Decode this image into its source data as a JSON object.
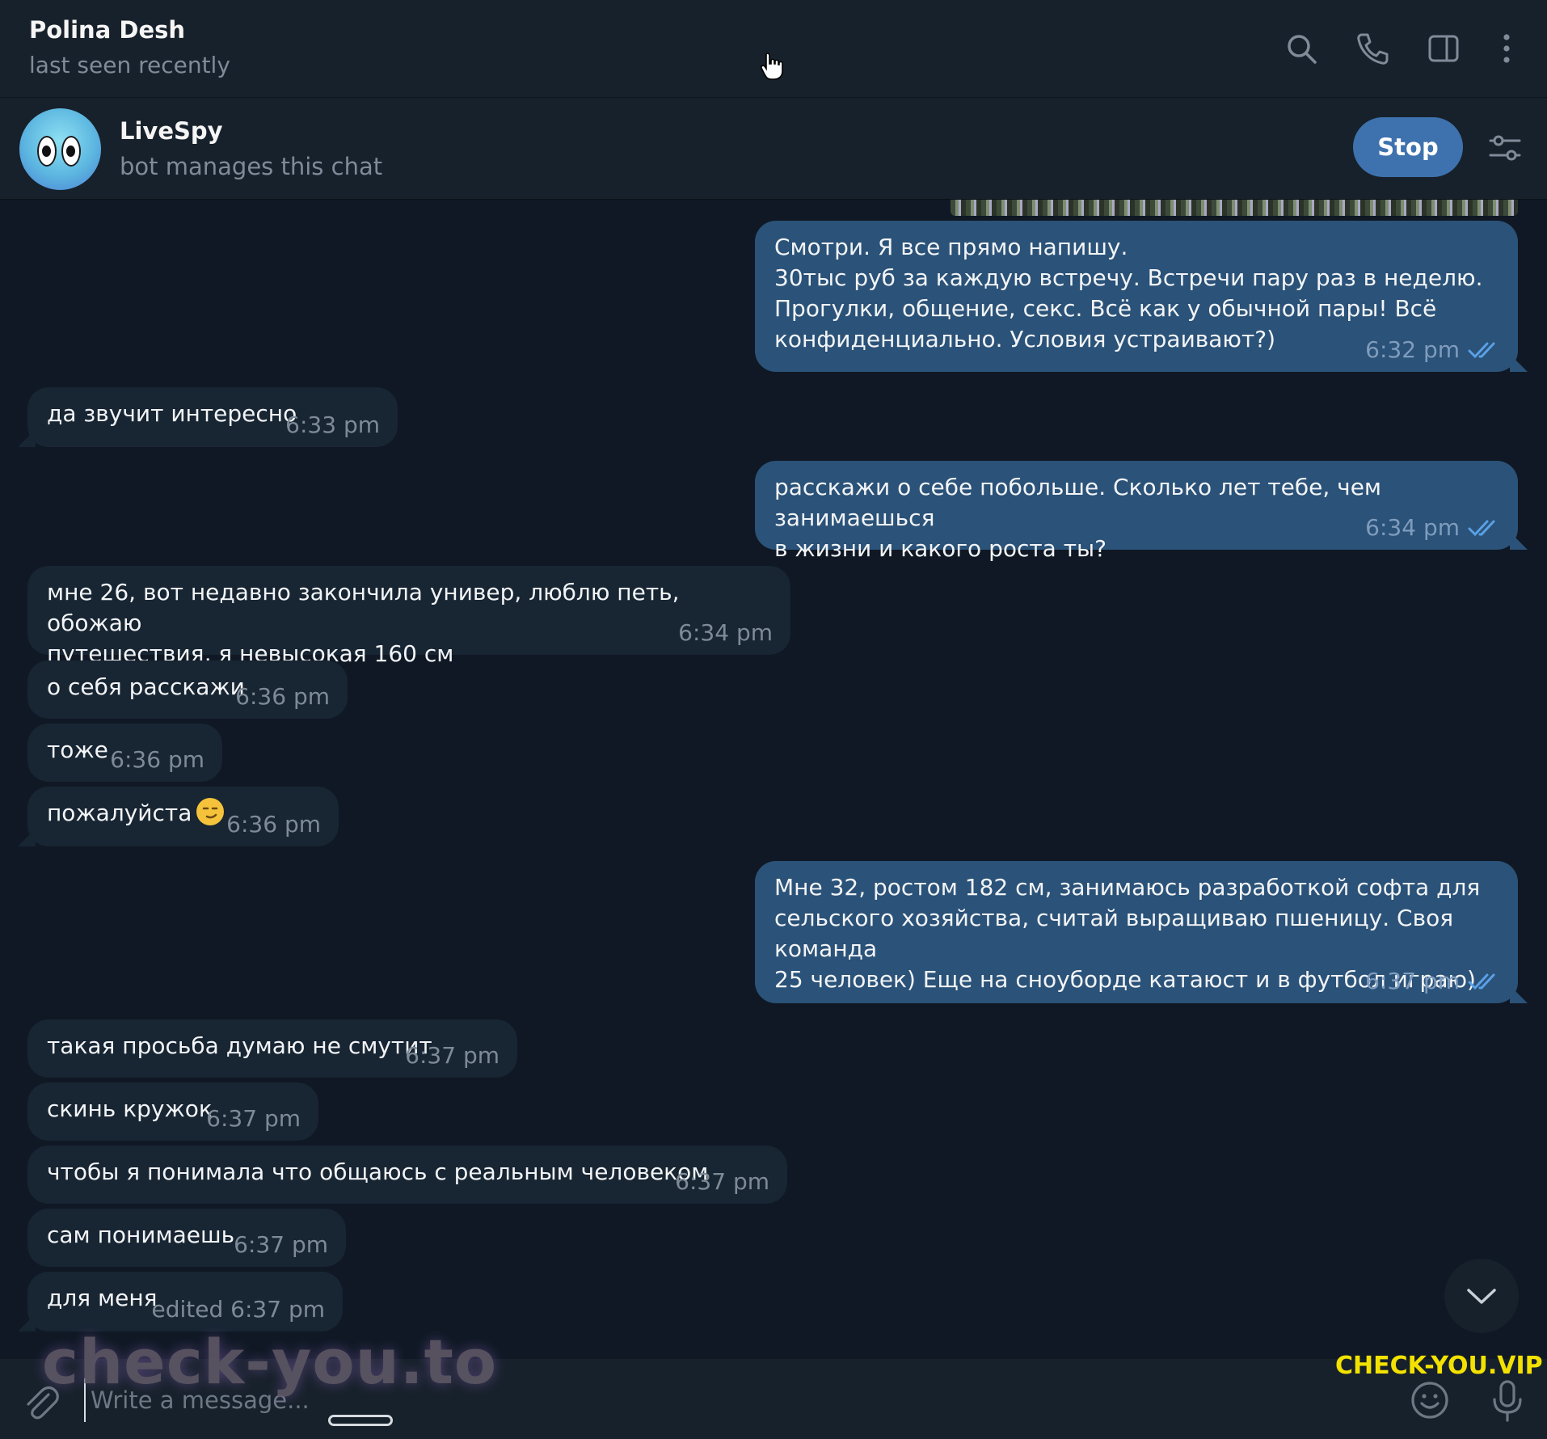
{
  "header": {
    "contact_name": "Polina Desh",
    "status": "last seen recently"
  },
  "bot": {
    "name": "LiveSpy",
    "subtitle": "bot manages this chat",
    "stop_label": "Stop"
  },
  "messages": [
    {
      "dir": "out",
      "text": "Смотри. Я все прямо напишу.\n30тыс руб за каждую встречу. Встречи пару раз в неделю.\nПрогулки, общение, секс. Всё как у обычной пары! Всё\nконфиденциально. Условия устраивают?)",
      "time": "6:32 pm"
    },
    {
      "dir": "in",
      "text": "да звучит интересно",
      "time": "6:33 pm"
    },
    {
      "dir": "out",
      "text": "расскажи о себе побольше. Сколько лет тебе, чем занимаешься\nв жизни и какого роста ты?",
      "time": "6:34 pm"
    },
    {
      "dir": "in",
      "text": "мне 26, вот недавно закончила универ, люблю петь, обожаю\nпутешествия, я невысокая 160 см",
      "time": "6:34 pm"
    },
    {
      "dir": "in",
      "text": "о себя расскажи",
      "time": "6:36 pm"
    },
    {
      "dir": "in",
      "text": "тоже",
      "time": "6:36 pm"
    },
    {
      "dir": "in",
      "text": "пожалуйста",
      "time": "6:36 pm"
    },
    {
      "dir": "out",
      "text": "Мне 32, ростом 182 см, занимаюсь разработкой софта для\nсельского хозяйства, считай выращиваю пшеницу. Своя команда\n25 человек) Еще на сноуборде катаюст и в футбол играю)",
      "time": "6:37 pm"
    },
    {
      "dir": "in",
      "text": "такая просьба думаю не смутит",
      "time": "6:37 pm"
    },
    {
      "dir": "in",
      "text": "скинь кружок",
      "time": "6:37 pm"
    },
    {
      "dir": "in",
      "text": "чтобы я понимала что общаюсь с реальным человеком",
      "time": "6:37 pm"
    },
    {
      "dir": "in",
      "text": "сам понимаешь",
      "time": "6:37 pm"
    },
    {
      "dir": "in",
      "text": "для меня",
      "time": "edited 6:37 pm"
    }
  ],
  "input": {
    "placeholder": "Write a message..."
  },
  "watermarks": {
    "left": "check-you.to",
    "right": "CHECK-YOU.VIP"
  },
  "icons": {
    "search": "search-icon",
    "call": "phone-icon",
    "sidebar": "sidebar-toggle-icon",
    "more": "more-vertical-icon",
    "bot_settings": "sliders-icon",
    "attach": "paperclip-icon",
    "emoji": "smile-icon",
    "mic": "microphone-icon",
    "scroll": "chevron-down-icon"
  },
  "colors": {
    "bg": "#0f1824",
    "panel": "#17212b",
    "incoming_bubble": "#182533",
    "outgoing_bubble": "#2b5278",
    "accent": "#3e72ae",
    "read_check": "#5aa0e6"
  }
}
